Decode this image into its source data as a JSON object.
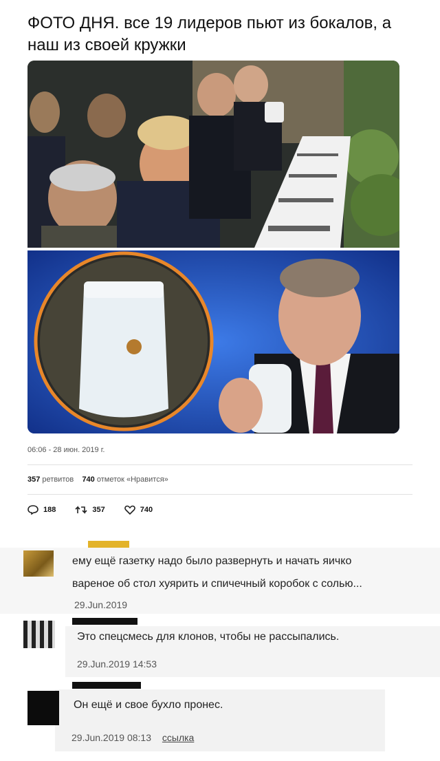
{
  "tweet": {
    "title": "ФОТО ДНЯ. все 19 лидеров пьют из бокалов, а наш из своей кружки",
    "time": "06:06 - 28 июн. 2019 г.",
    "retweets_count": "357",
    "retweets_label": "ретвитов",
    "likes_count": "740",
    "likes_label": "отметок «Нравится»",
    "actions": {
      "reply_count": "188",
      "retweet_count": "357",
      "like_count": "740"
    }
  },
  "comments": [
    {
      "text_line1": "ему ещё газетку надо было развернуть и начать яичко",
      "text_line2": "вареное  об стол хуярить и спичечный коробок с солью...",
      "date": "29.Jun.2019"
    },
    {
      "text": "Это спецсмесь  для клонов, чтобы не рассыпались.",
      "date": "29.Jun.2019 14:53"
    },
    {
      "text": "Он ещё и свое бухло пронес.",
      "date": "29.Jun.2019 08:13",
      "link": "ссылка"
    }
  ],
  "colors": {
    "mug_ring": "#e8872a",
    "studio_blue": "#2a5bd0",
    "comment_bg": "#f3f3f3"
  },
  "icons": [
    "reply-icon",
    "retweet-icon",
    "heart-icon"
  ]
}
